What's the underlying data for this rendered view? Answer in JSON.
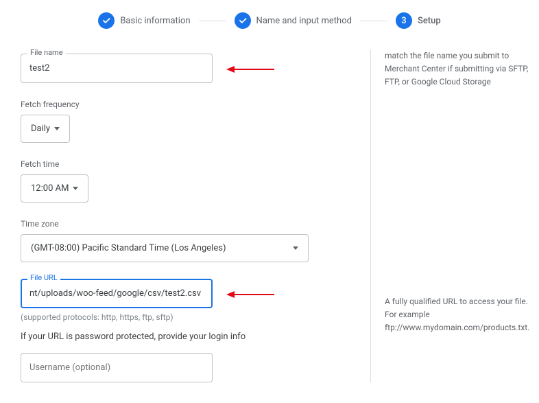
{
  "stepper": {
    "step1": "Basic information",
    "step2": "Name and input method",
    "step3_num": "3",
    "step3": "Setup"
  },
  "file_name": {
    "label": "File name",
    "value": "test2"
  },
  "fetch_frequency": {
    "label": "Fetch frequency",
    "value": "Daily"
  },
  "fetch_time": {
    "label": "Fetch time",
    "value": "12:00 AM"
  },
  "time_zone": {
    "label": "Time zone",
    "value": "(GMT-08:00) Pacific Standard Time (Los Angeles)"
  },
  "file_url": {
    "label": "File URL",
    "value": "nt/uploads/woo-feed/google/csv/test2.csv"
  },
  "protocols_hint": "(supported protocols: http, https, ftp, sftp)",
  "password_text": "If your URL is password protected, provide your login info",
  "username": {
    "placeholder": "Username (optional)"
  },
  "help": {
    "file_name": "match the file name you submit to Merchant Center if submitting via SFTP, FTP, or Google Cloud Storage",
    "file_url": "A fully qualified URL to access your file. For example ftp://www.mydomain.com/products.txt."
  }
}
